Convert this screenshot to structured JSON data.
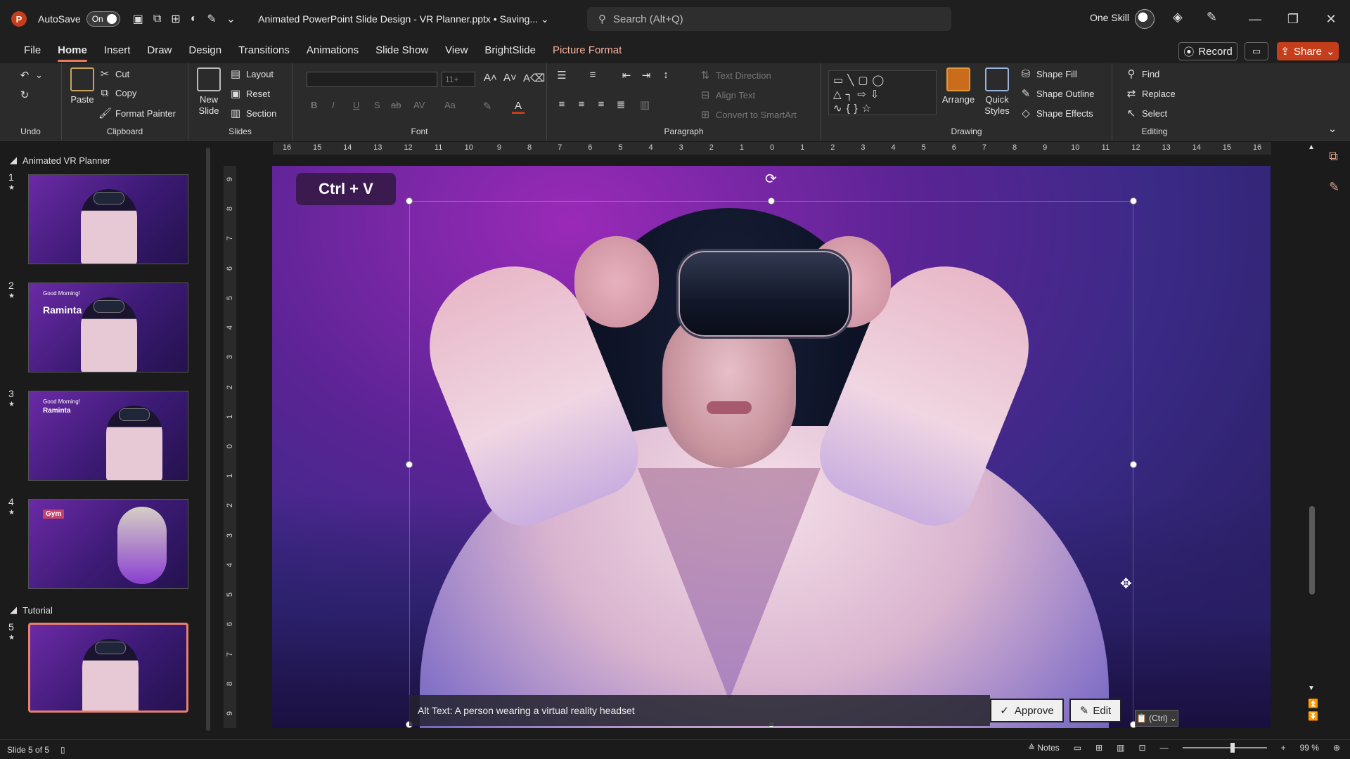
{
  "app": {
    "logo_letter": "P",
    "autosave_label": "AutoSave",
    "autosave_state": "On",
    "doc_title": "Animated PowerPoint Slide Design - VR Planner.pptx • Saving...",
    "search_placeholder": "Search (Alt+Q)",
    "user_name": "One Skill"
  },
  "menu": {
    "tabs": [
      "File",
      "Home",
      "Insert",
      "Draw",
      "Design",
      "Transitions",
      "Animations",
      "Slide Show",
      "View",
      "BrightSlide",
      "Picture Format"
    ],
    "active": "Home",
    "record_label": "Record",
    "share_label": "Share"
  },
  "ribbon": {
    "undo_group": "Undo",
    "clipboard": {
      "label": "Clipboard",
      "paste": "Paste",
      "cut": "Cut",
      "copy": "Copy",
      "format_painter": "Format Painter"
    },
    "slides": {
      "label": "Slides",
      "new_slide": "New",
      "new_slide_2": "Slide",
      "layout": "Layout",
      "reset": "Reset",
      "section": "Section"
    },
    "font": {
      "label": "Font",
      "size": "11+",
      "bold": "B",
      "italic": "I",
      "underline": "U",
      "shadow": "S",
      "strike": "ab",
      "spacing": "AV",
      "case": "Aa"
    },
    "paragraph": {
      "label": "Paragraph",
      "text_direction": "Text Direction",
      "align_text": "Align Text",
      "convert": "Convert to SmartArt"
    },
    "drawing": {
      "label": "Drawing",
      "arrange": "Arrange",
      "quick_styles": "Quick",
      "quick_styles_2": "Styles",
      "shape_fill": "Shape Fill",
      "shape_outline": "Shape Outline",
      "shape_effects": "Shape Effects"
    },
    "editing": {
      "label": "Editing",
      "find": "Find",
      "replace": "Replace",
      "select": "Select"
    }
  },
  "slides_panel": {
    "section1": "Animated VR Planner",
    "section2": "Tutorial",
    "slides": [
      {
        "num": "1"
      },
      {
        "num": "2",
        "text": "Raminta",
        "small": "Good Morning!"
      },
      {
        "num": "3",
        "text": "Raminta",
        "small": "Good Morning!"
      },
      {
        "num": "4",
        "text": "Gym",
        "small": ""
      },
      {
        "num": "5"
      }
    ]
  },
  "ruler": {
    "h": [
      "16",
      "15",
      "14",
      "13",
      "12",
      "11",
      "10",
      "9",
      "8",
      "7",
      "6",
      "5",
      "4",
      "3",
      "2",
      "1",
      "0",
      "1",
      "2",
      "3",
      "4",
      "5",
      "6",
      "7",
      "8",
      "9",
      "10",
      "11",
      "12",
      "13",
      "14",
      "15",
      "16"
    ],
    "v": [
      "9",
      "8",
      "7",
      "6",
      "5",
      "4",
      "3",
      "2",
      "1",
      "0",
      "1",
      "2",
      "3",
      "4",
      "5",
      "6",
      "7",
      "8",
      "9"
    ]
  },
  "canvas": {
    "shortcut_badge": "Ctrl + V",
    "alt_text": "Alt Text: A person wearing a virtual reality headset",
    "approve_label": "Approve",
    "edit_label": "Edit",
    "paste_options": "(Ctrl)"
  },
  "status": {
    "slide_info": "Slide 5 of 5",
    "notes": "Notes",
    "zoom": "99 %",
    "zoom_fraction": 0.6
  },
  "colors": {
    "accent": "#c43e1c",
    "active_tab_underline": "#e8795c",
    "selected_thumb": "#e87f72"
  }
}
